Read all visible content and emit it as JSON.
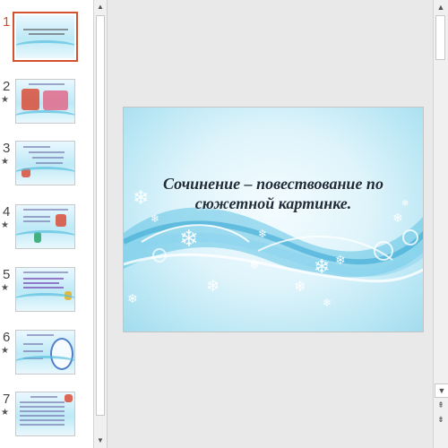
{
  "thumbnails": [
    {
      "number": "1",
      "active": true,
      "star": ""
    },
    {
      "number": "2",
      "active": false,
      "star": "★"
    },
    {
      "number": "3",
      "active": false,
      "star": "★"
    },
    {
      "number": "4",
      "active": false,
      "star": "★"
    },
    {
      "number": "5",
      "active": false,
      "star": "★"
    },
    {
      "number": "6",
      "active": false,
      "star": "★"
    },
    {
      "number": "7",
      "active": false,
      "star": "★"
    }
  ],
  "slide": {
    "title": "Сочинение – повествование по сюжетной картинке."
  },
  "scroll": {
    "up_arrow": "▲",
    "down_arrow": "▼",
    "prev_slide": "⇞",
    "next_slide": "⇟"
  },
  "colors": {
    "accent": "#d35230",
    "slide_wave": "#5ac0e0"
  }
}
